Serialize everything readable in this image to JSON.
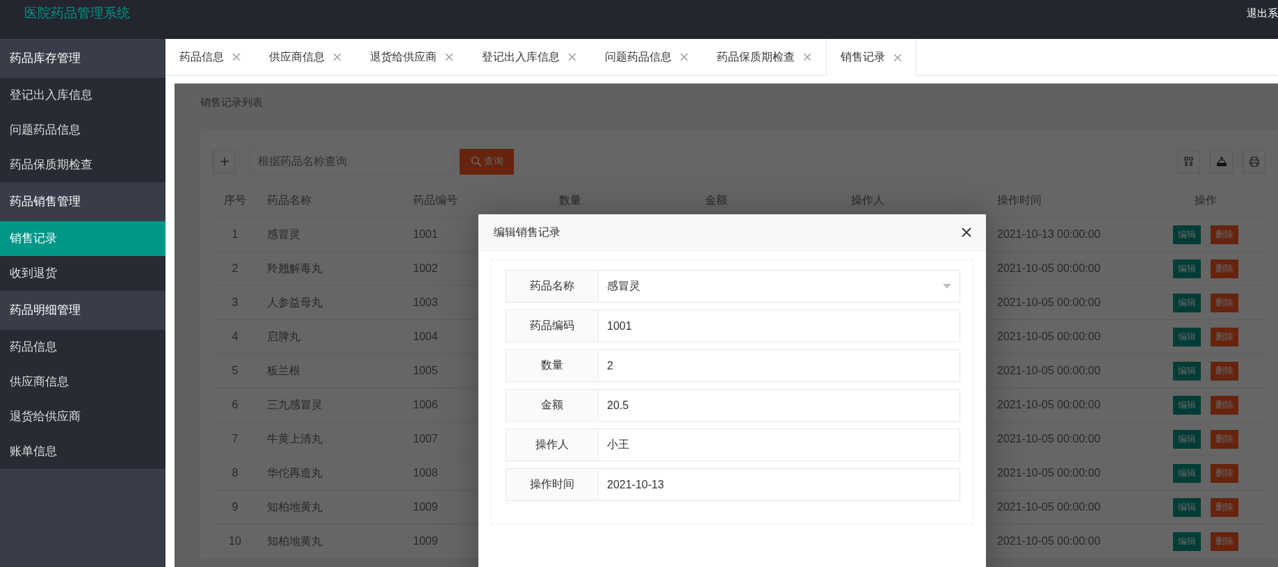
{
  "header": {
    "title": "医院药品管理系统",
    "logout": "退出系"
  },
  "sidebar": {
    "groups": [
      {
        "title": "药品库存管理",
        "items": [
          {
            "label": "登记出入库信息",
            "selected": false
          },
          {
            "label": "问题药品信息",
            "selected": false
          },
          {
            "label": "药品保质期检查",
            "selected": false
          }
        ]
      },
      {
        "title": "药品销售管理",
        "items": [
          {
            "label": "销售记录",
            "selected": true
          },
          {
            "label": "收到退货",
            "selected": false
          }
        ]
      },
      {
        "title": "药品明细管理",
        "items": [
          {
            "label": "药品信息",
            "selected": false
          },
          {
            "label": "供应商信息",
            "selected": false
          },
          {
            "label": "退货给供应商",
            "selected": false
          },
          {
            "label": "账单信息",
            "selected": false
          }
        ]
      }
    ]
  },
  "tabs": [
    {
      "label": "药品信息",
      "selected": false
    },
    {
      "label": "供应商信息",
      "selected": false
    },
    {
      "label": "退货给供应商",
      "selected": false
    },
    {
      "label": "登记出入库信息",
      "selected": false
    },
    {
      "label": "问题药品信息",
      "selected": false
    },
    {
      "label": "药品保质期检查",
      "selected": false
    },
    {
      "label": "销售记录",
      "selected": true
    }
  ],
  "page": {
    "title": "销售记录列表",
    "search": {
      "placeholder": "根据药品名称查询"
    },
    "search_button": "查询",
    "table": {
      "columns": [
        "序号",
        "药品名称",
        "药品编号",
        "数量",
        "金额",
        "操作人",
        "操作时间",
        "操作"
      ],
      "rows": [
        {
          "index": "1",
          "name": "感冒灵",
          "code": "1001",
          "time": "2021-10-13 00:00:00",
          "actions": [
            "编辑",
            "删除"
          ]
        },
        {
          "index": "2",
          "name": "羚翘解毒丸",
          "code": "1002",
          "time": "2021-10-05 00:00:00",
          "actions": [
            "编辑",
            "删除"
          ]
        },
        {
          "index": "3",
          "name": "人参益母丸",
          "code": "1003",
          "time": "2021-10-05 00:00:00",
          "actions": [
            "编辑",
            "删除"
          ]
        },
        {
          "index": "4",
          "name": "启脾丸",
          "code": "1004",
          "time": "2021-10-05 00:00:00",
          "actions": [
            "编辑",
            "删除"
          ]
        },
        {
          "index": "5",
          "name": "板兰根",
          "code": "1005",
          "time": "2021-10-05 00:00:00",
          "actions": [
            "编辑",
            "删除"
          ]
        },
        {
          "index": "6",
          "name": "三九感冒灵",
          "code": "1006",
          "time": "2021-10-05 00:00:00",
          "actions": [
            "编辑",
            "删除"
          ]
        },
        {
          "index": "7",
          "name": "牛黄上清丸",
          "code": "1007",
          "time": "2021-10-05 00:00:00",
          "actions": [
            "编辑",
            "删除"
          ]
        },
        {
          "index": "8",
          "name": "华佗再造丸",
          "code": "1008",
          "time": "2021-10-05 00:00:00",
          "actions": [
            "编辑",
            "删除"
          ]
        },
        {
          "index": "9",
          "name": "知柏地黄丸",
          "code": "1009",
          "time": "2021-10-05 00:00:00",
          "actions": [
            "编辑",
            "删除"
          ]
        },
        {
          "index": "10",
          "name": "知柏地黄丸",
          "code": "1009",
          "time": "2021-10-05 00:00:00",
          "actions": [
            "编辑",
            "删除"
          ]
        }
      ]
    }
  },
  "dialog": {
    "title": "编辑销售记录",
    "fields": [
      {
        "label": "药品名称",
        "value": "感冒灵",
        "kind": "select"
      },
      {
        "label": "药品编码",
        "value": "1001",
        "kind": "text"
      },
      {
        "label": "数量",
        "value": "2",
        "kind": "text"
      },
      {
        "label": "金额",
        "value": "20.5",
        "kind": "text"
      },
      {
        "label": "操作人",
        "value": "小王",
        "kind": "text"
      },
      {
        "label": "操作时间",
        "value": "2021-10-13",
        "kind": "text"
      }
    ]
  }
}
